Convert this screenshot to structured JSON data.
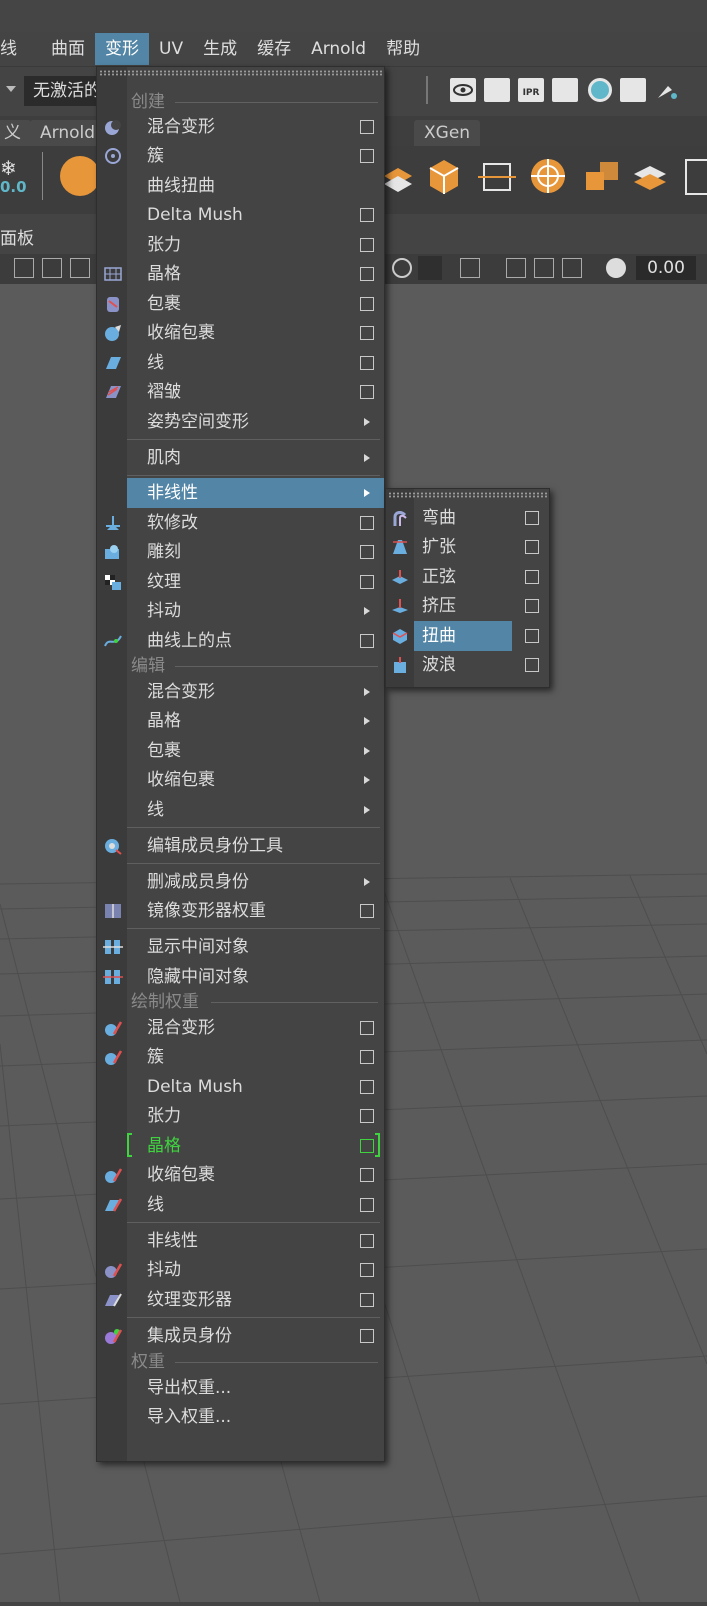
{
  "menubar": {
    "items": [
      {
        "label": "线",
        "active": false
      },
      {
        "label": "曲面",
        "active": false
      },
      {
        "label": "变形",
        "active": true
      },
      {
        "label": "UV",
        "active": false
      },
      {
        "label": "生成",
        "active": false
      },
      {
        "label": "缓存",
        "active": false
      },
      {
        "label": "Arnold",
        "active": false
      },
      {
        "label": "帮助",
        "active": false
      }
    ]
  },
  "statusline": {
    "workspace_value": "无激活的",
    "ipr_label": "IPR"
  },
  "shelf": {
    "tabs": [
      "义",
      "Arnold",
      "XGen"
    ],
    "snowflake_value": "0.0"
  },
  "panel": {
    "label": "面板",
    "time_value": "0.00"
  },
  "main_menu": {
    "sections": {
      "create": "创建",
      "edit": "编辑",
      "paint": "绘制权重",
      "weights": "权重"
    },
    "items": {
      "blend_shape": "混合变形",
      "cluster": "簇",
      "curve_warp": "曲线扭曲",
      "delta_mush": "Delta Mush",
      "tension": "张力",
      "lattice": "晶格",
      "wrap": "包裹",
      "shrink_wrap": "收缩包裹",
      "wire": "线",
      "wrinkle": "褶皱",
      "pose_space": "姿势空间变形",
      "muscle": "肌肉",
      "nonlinear": "非线性",
      "soft_mod": "软修改",
      "sculpt": "雕刻",
      "texture": "纹理",
      "jiggle": "抖动",
      "point_on_curve": "曲线上的点",
      "edit_blend_shape": "混合变形",
      "edit_lattice": "晶格",
      "edit_wrap": "包裹",
      "edit_shrink_wrap": "收缩包裹",
      "edit_wire": "线",
      "edit_membership_tool": "编辑成员身份工具",
      "prune_membership": "删减成员身份",
      "mirror_weights": "镜像变形器权重",
      "show_intermediate": "显示中间对象",
      "hide_intermediate": "隐藏中间对象",
      "paint_blend_shape": "混合变形",
      "paint_cluster": "簇",
      "paint_delta_mush": "Delta Mush",
      "paint_tension": "张力",
      "paint_lattice": "晶格",
      "paint_shrink_wrap": "收缩包裹",
      "paint_wire": "线",
      "paint_nonlinear": "非线性",
      "paint_jiggle": "抖动",
      "paint_texture_deformer": "纹理变形器",
      "paint_set_membership": "集成员身份",
      "export_weights": "导出权重...",
      "import_weights": "导入权重..."
    }
  },
  "sub_menu": {
    "items": {
      "bend": "弯曲",
      "flare": "扩张",
      "sine": "正弦",
      "squash": "挤压",
      "twist": "扭曲",
      "wave": "波浪"
    }
  },
  "colors": {
    "highlight": "#5285a6",
    "active_green": "#3fd43f",
    "shelf_orange": "#e8963a"
  }
}
